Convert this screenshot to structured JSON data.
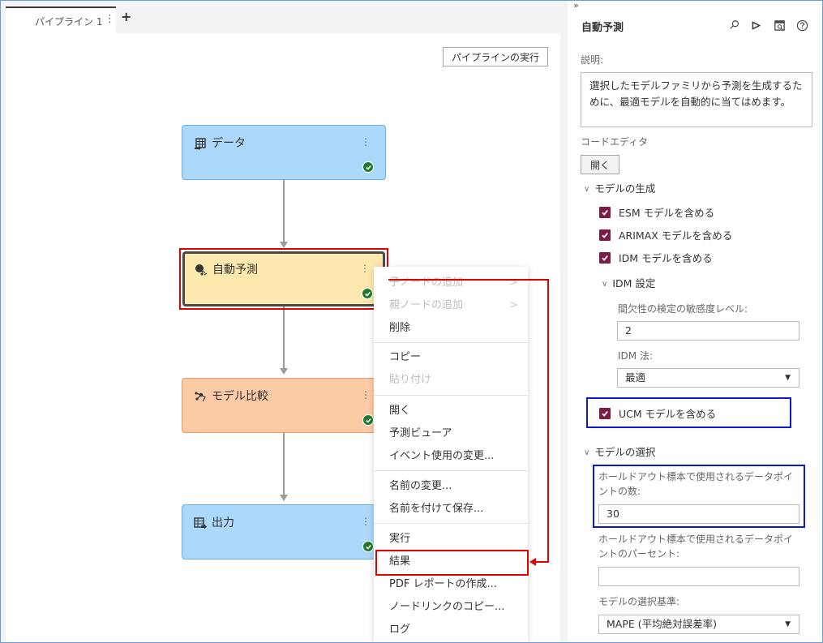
{
  "tabs": {
    "active_label": "パイプライン 1",
    "menu_icon": "⋮",
    "add_icon": "+"
  },
  "canvas": {
    "run_pipeline_label": "パイプラインの実行",
    "nodes": [
      {
        "label": "データ",
        "type": "data",
        "status": "success"
      },
      {
        "label": "自動予測",
        "type": "auto-forecast",
        "status": "success",
        "selected": true
      },
      {
        "label": "モデル比較",
        "type": "model-comparison",
        "status": "success"
      },
      {
        "label": "出力",
        "type": "output",
        "status": "success"
      }
    ],
    "node_menu_icon": "⋮"
  },
  "context_menu": {
    "items": [
      {
        "label": "子ノードの追加",
        "disabled": true,
        "submenu": true
      },
      {
        "label": "親ノードの追加",
        "disabled": true,
        "submenu": true
      },
      {
        "label": "削除",
        "disabled": false
      },
      {
        "label": "コピー",
        "disabled": false
      },
      {
        "label": "貼り付け",
        "disabled": true
      },
      {
        "label": "開く",
        "disabled": false
      },
      {
        "label": "予測ビューア",
        "disabled": false
      },
      {
        "label": "イベント使用の変更...",
        "disabled": false
      },
      {
        "label": "名前の変更...",
        "disabled": false
      },
      {
        "label": "名前を付けて保存...",
        "disabled": false
      },
      {
        "label": "実行",
        "disabled": false
      },
      {
        "label": "結果",
        "disabled": false,
        "highlighted": true
      },
      {
        "label": "PDF レポートの作成...",
        "disabled": false
      },
      {
        "label": "ノードリンクのコピー...",
        "disabled": false
      },
      {
        "label": "ログ",
        "disabled": false
      }
    ],
    "submenu_icon": ">"
  },
  "panel": {
    "collapse_icon": "»",
    "title": "自動予測",
    "description_label": "説明:",
    "description_text": "選択したモデルファミリから予測を生成するために、最適モデルを自動的に当てはめます。",
    "code_editor_label": "コードエディタ",
    "open_button": "開く",
    "model_generation": {
      "heading": "モデルの生成",
      "include_esm": {
        "label": "ESM モデルを含める",
        "checked": true
      },
      "include_arimax": {
        "label": "ARIMAX モデルを含める",
        "checked": true
      },
      "include_idm": {
        "label": "IDM モデルを含める",
        "checked": true
      },
      "idm_settings": {
        "heading": "IDM 設定",
        "sensitivity_label": "間欠性の検定の敏感度レベル:",
        "sensitivity_value": "2",
        "method_label": "IDM 法:",
        "method_value": "最適"
      },
      "include_ucm": {
        "label": "UCM モデルを含める",
        "checked": true
      }
    },
    "model_selection": {
      "heading": "モデルの選択",
      "holdout_count_label": "ホールドアウト標本で使用されるデータポイントの数:",
      "holdout_count_value": "30",
      "holdout_percent_label": "ホールドアウト標本で使用されるデータポイントのパーセント:",
      "holdout_percent_value": "",
      "criterion_label": "モデルの選択基準:",
      "criterion_value": "MAPE (平均絶対誤差率)"
    }
  },
  "colors": {
    "checkbox": "#7d1a47",
    "highlight_red": "#e00000",
    "highlight_blue": "#0a17d8",
    "node_blue": "#acd8fc",
    "node_yellow": "#fde8ad",
    "node_orange": "#fdcaa6",
    "success_green": "#1f7a2e"
  }
}
